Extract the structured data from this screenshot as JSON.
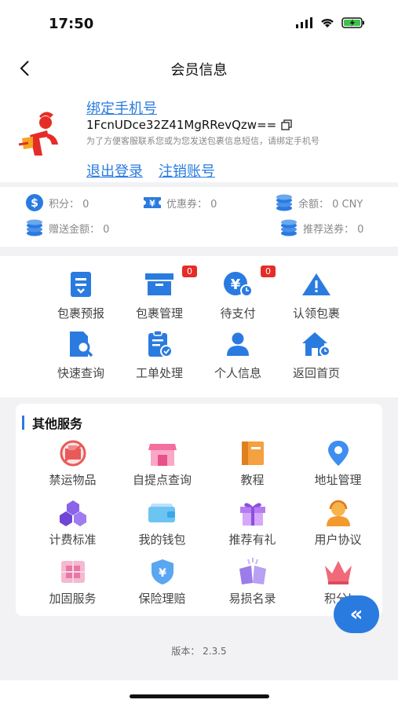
{
  "status_bar": {
    "time": "17:50"
  },
  "nav": {
    "title": "会员信息"
  },
  "profile": {
    "bind_phone": "绑定手机号",
    "uid": "1FcnUDce32Z41MgRRevQzw==",
    "tip": "为了方便客服联系您或为您发送包裹信息短信，请绑定手机号",
    "logout": "退出登录",
    "cancel_account": "注销账号"
  },
  "stats": {
    "points": "积分： 0",
    "coupons": "优惠券： 0",
    "balance": "余额： 0 CNY",
    "gift_amount": "赠送金额： 0",
    "referral": "推荐送券： 0"
  },
  "menu": [
    {
      "label": "包裹预报",
      "icon": "package-forecast-icon"
    },
    {
      "label": "包裹管理",
      "icon": "package-manage-icon",
      "badge": "0"
    },
    {
      "label": "待支付",
      "icon": "pending-payment-icon",
      "badge": "0"
    },
    {
      "label": "认领包裹",
      "icon": "claim-package-icon"
    },
    {
      "label": "快速查询",
      "icon": "quick-search-icon"
    },
    {
      "label": "工单处理",
      "icon": "ticket-icon"
    },
    {
      "label": "个人信息",
      "icon": "person-icon"
    },
    {
      "label": "返回首页",
      "icon": "home-icon"
    }
  ],
  "other_services": {
    "title": "其他服务",
    "items": [
      {
        "label": "禁运物品",
        "icon": "prohibited-items-icon"
      },
      {
        "label": "自提点查询",
        "icon": "pickup-point-icon"
      },
      {
        "label": "教程",
        "icon": "tutorial-icon"
      },
      {
        "label": "地址管理",
        "icon": "location-icon"
      },
      {
        "label": "计费标准",
        "icon": "pricing-icon"
      },
      {
        "label": "我的钱包",
        "icon": "wallet-icon"
      },
      {
        "label": "推荐有礼",
        "icon": "gift-icon"
      },
      {
        "label": "用户协议",
        "icon": "user-agreement-icon"
      },
      {
        "label": "加固服务",
        "icon": "reinforce-icon"
      },
      {
        "label": "保险理赔",
        "icon": "insurance-icon"
      },
      {
        "label": "易损名录",
        "icon": "fragile-list-icon"
      },
      {
        "label": "积分|",
        "icon": "crown-icon"
      }
    ]
  },
  "fab": {
    "label": "«"
  },
  "version": "版本： 2.3.5",
  "colors": {
    "accent": "#2a7be0",
    "badge": "#e52d27"
  }
}
